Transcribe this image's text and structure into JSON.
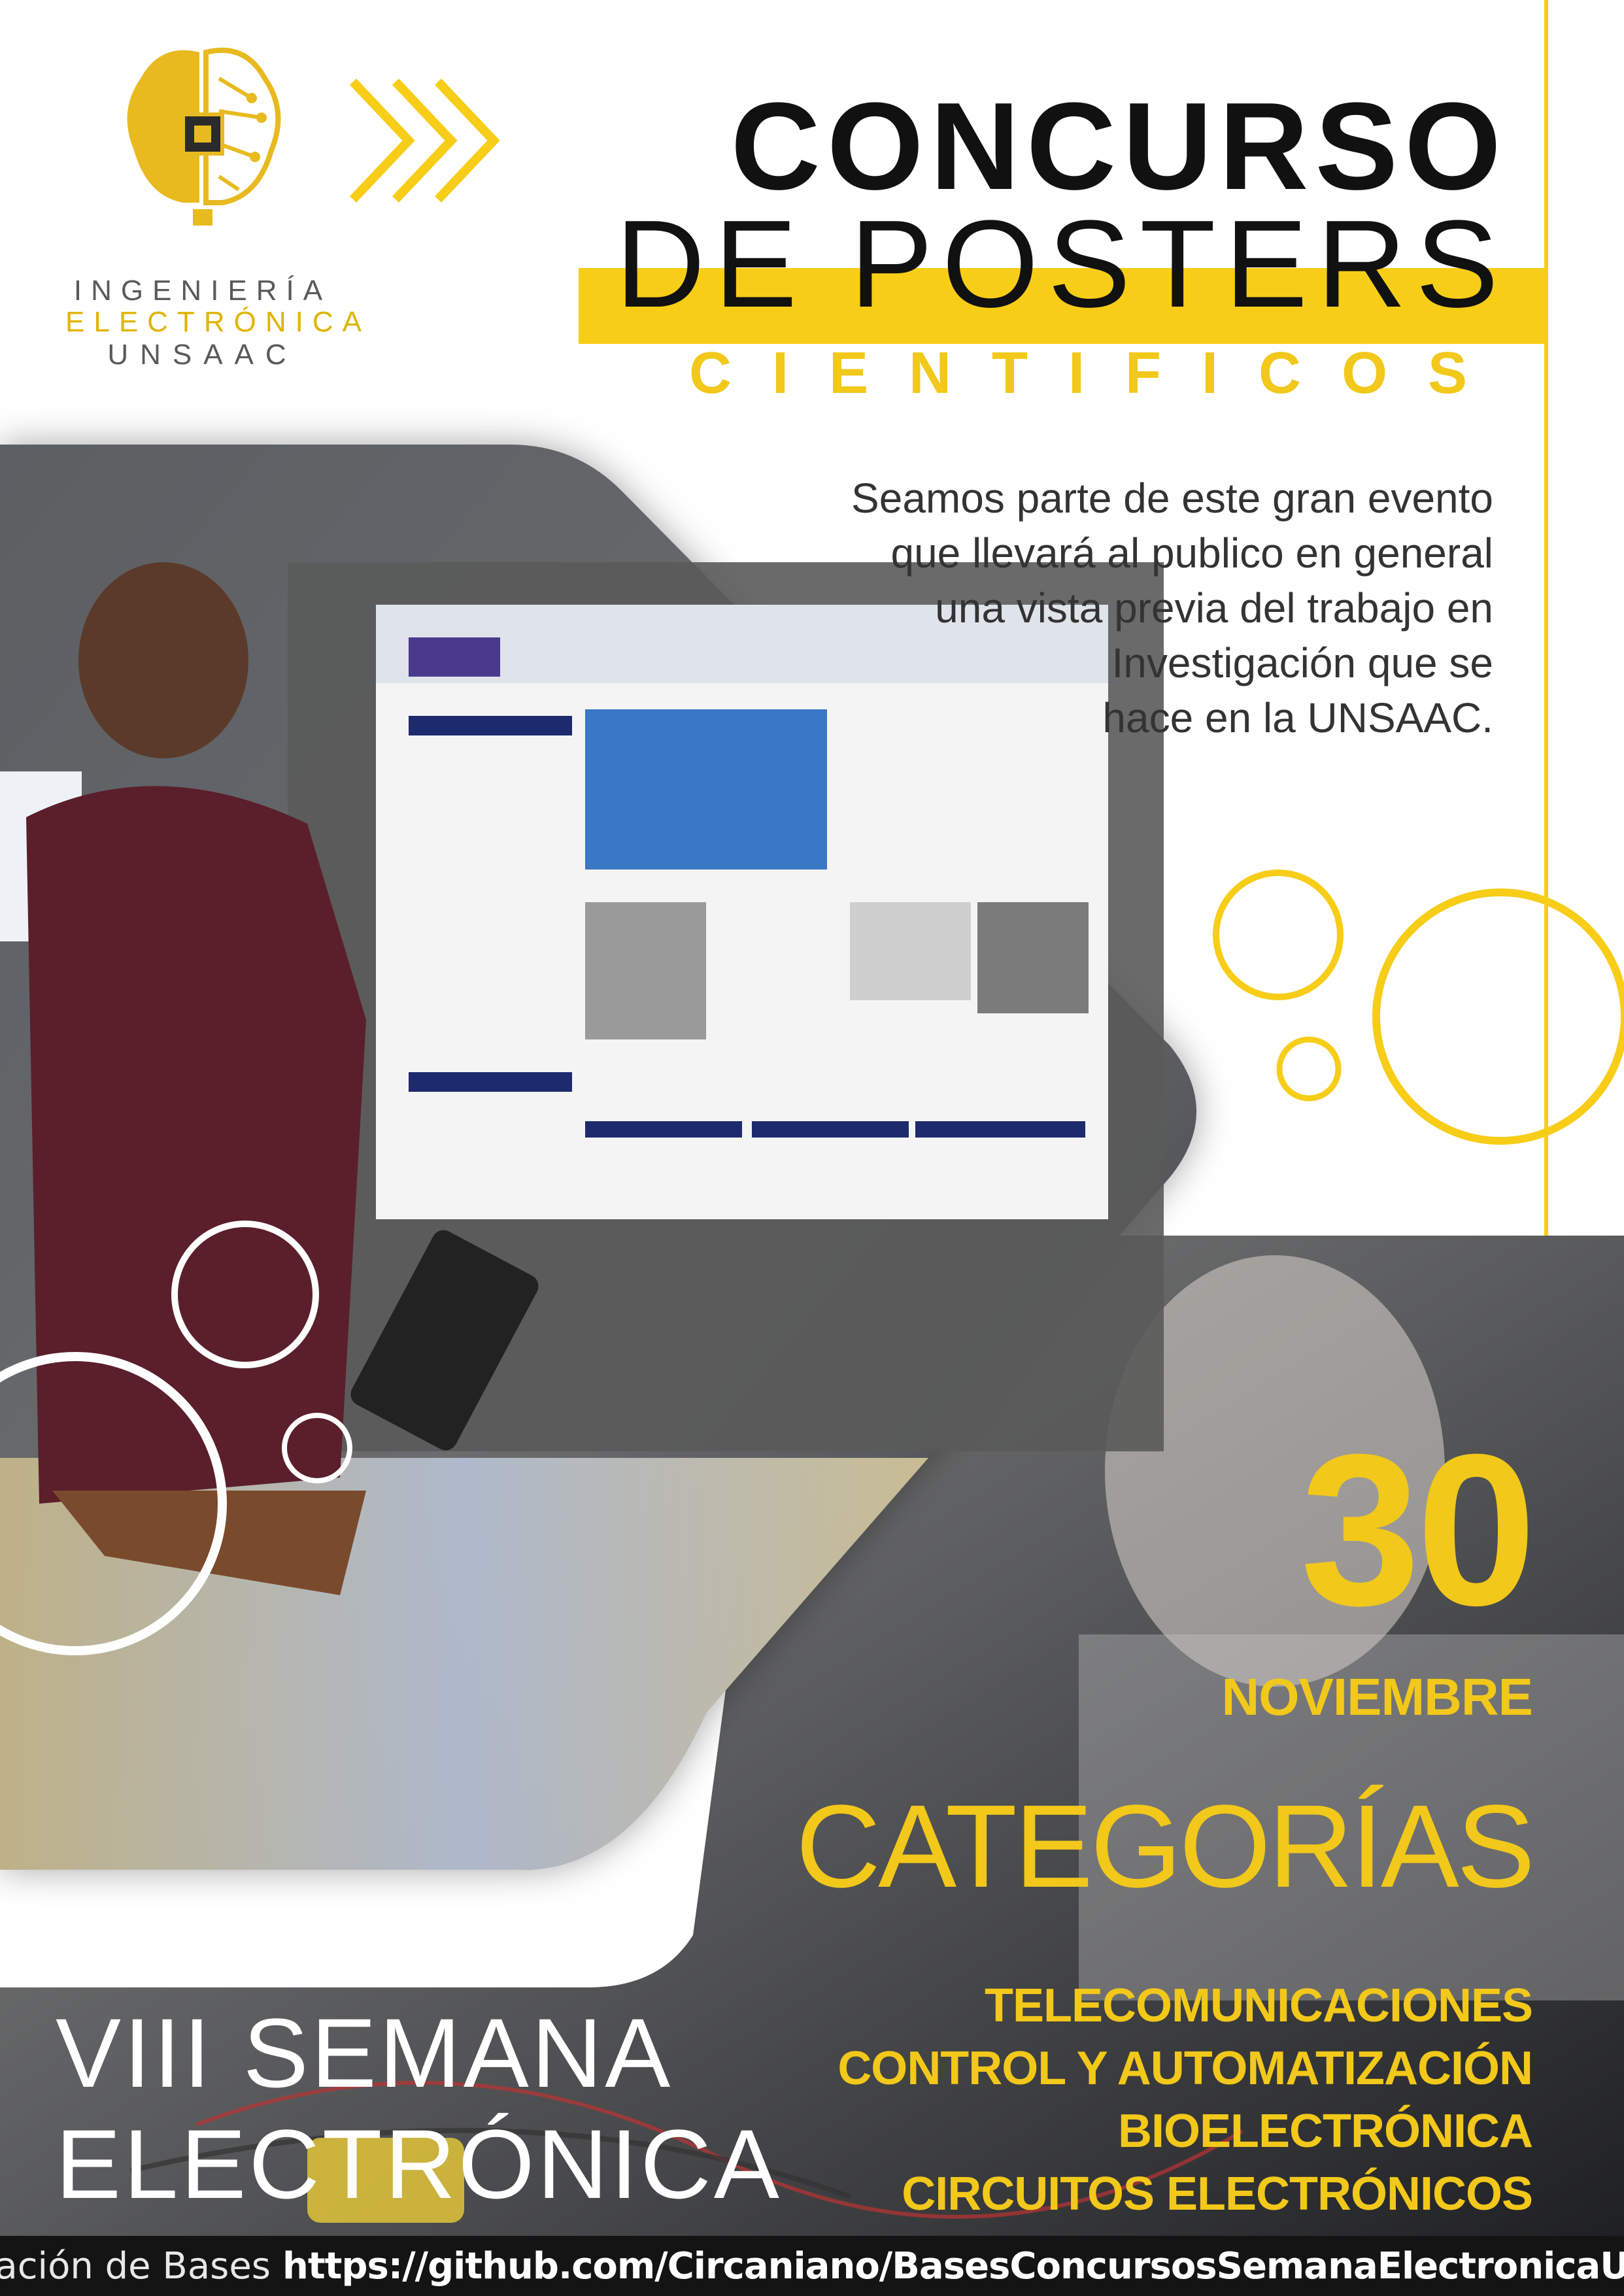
{
  "logo": {
    "line1": "INGENIERÍA",
    "line2": "ELECTRÓNICA",
    "line3": "UNSAAC"
  },
  "title": {
    "line1": "CONCURSO",
    "line2": "DE POSTERS",
    "line3": "CIENTIFICOS"
  },
  "intro": {
    "lines": [
      "Seamos parte de este gran evento",
      "que llevará al publico en general",
      "una vista previa del trabajo en",
      "Investigación que se",
      "hace en la UNSAAC."
    ]
  },
  "event": {
    "day": "30",
    "month": "NOVIEMBRE"
  },
  "categories": {
    "heading": "CATEGORÍAS",
    "items": [
      "TELECOMUNICACIONES",
      "CONTROL Y AUTOMATIZACIÓN",
      "BIOELECTRÓNICA",
      "CIRCUITOS ELECTRÓNICOS"
    ]
  },
  "week": {
    "line1": "VIII SEMANA",
    "line2": "ELECTRÓNICA"
  },
  "footer": {
    "label": "Presentación de Bases",
    "link": "https://github.com/Circaniano/BasesConcursosSemanaElectronicaUNSAAC"
  },
  "colors": {
    "accent_yellow": "#f7cd18",
    "text_dark": "#111111",
    "footer_bg": "#141414"
  },
  "icons": [
    "brain-chip-logo-icon",
    "chevrons-right-icon"
  ]
}
